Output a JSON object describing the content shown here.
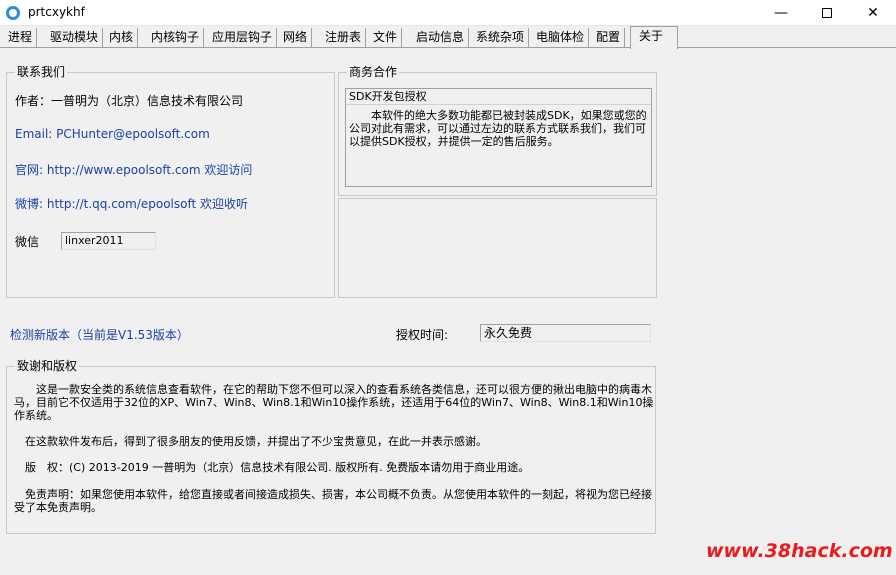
{
  "window": {
    "title": "prtcxykhf",
    "minimize": "—",
    "close": "✕"
  },
  "tabs": [
    "进程",
    "驱动模块",
    "内核",
    "内核钩子",
    "应用层钩子",
    "网络",
    "注册表",
    "文件",
    "启动信息",
    "系统杂项",
    "电脑体检",
    "配置",
    "关于"
  ],
  "contact": {
    "title": "联系我们",
    "author": "作者：一普明为（北京）信息技术有限公司",
    "email": "Email: PCHunter@epoolsoft.com",
    "website": "官网: http://www.epoolsoft.com 欢迎访问",
    "weibo": "微博: http://t.qq.com/epoolsoft 欢迎收听",
    "wechat_label": "微信",
    "wechat_value": "linxer2011"
  },
  "business": {
    "title": "商务合作",
    "sdk_title": "SDK开发包授权",
    "sdk_text": "本软件的绝大多数功能都已被封装成SDK，如果您或您的公司对此有需求，可以通过左边的联系方式联系我们，我们可以提供SDK授权，并提供一定的售后服务。"
  },
  "version": {
    "check_link": "检测新版本（当前是V1.53版本）",
    "license_label": "授权时间:",
    "license_value": "永久免费"
  },
  "credits": {
    "title": "致谢和版权",
    "p1": "这是一款安全类的系统信息查看软件，在它的帮助下您不但可以深入的查看系统各类信息，还可以很方便的揪出电脑中的病毒木马，目前它不仅适用于32位的XP、Win7、Win8、Win8.1和Win10操作系统，还适用于64位的Win7、Win8、Win8.1和Win10操作系统。",
    "p2": "在这款软件发布后，得到了很多朋友的使用反馈，并提出了不少宝贵意见，在此一并表示感谢。",
    "p3": "版　权：(C) 2013-2019 一普明为（北京）信息技术有限公司. 版权所有. 免费版本请勿用于商业用途。",
    "p4": "免责声明：如果您使用本软件，给您直接或者间接造成损失、损害，本公司概不负责。从您使用本软件的一刻起，将视为您已经接受了本免责声明。"
  },
  "watermark": "www.38hack.com"
}
